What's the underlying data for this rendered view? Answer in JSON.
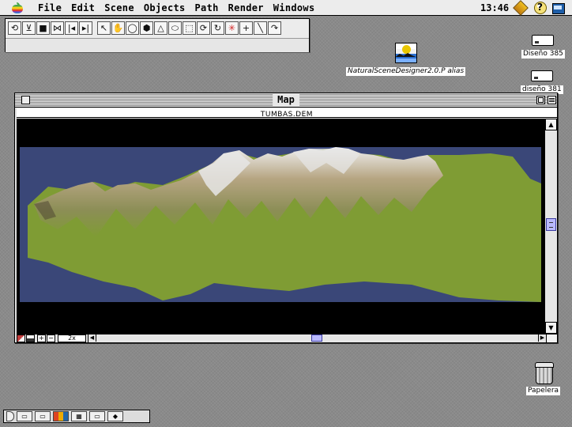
{
  "menubar": {
    "items": [
      "File",
      "Edit",
      "Scene",
      "Objects",
      "Path",
      "Render",
      "Windows"
    ],
    "clock": "13:46",
    "help_label": "?"
  },
  "toolbar": {
    "tools": [
      {
        "name": "undo-tool",
        "glyph": "⟲"
      },
      {
        "name": "stop-tool",
        "glyph": "⊻"
      },
      {
        "name": "pause-tool",
        "glyph": "■"
      },
      {
        "name": "center-tool",
        "glyph": "⋈"
      },
      {
        "name": "first-frame-tool",
        "glyph": "|◂"
      },
      {
        "name": "last-frame-tool",
        "glyph": "▸|"
      },
      {
        "name": "pointer-tool",
        "glyph": "↖"
      },
      {
        "name": "hand-tool",
        "glyph": "✋"
      },
      {
        "name": "sphere-tool",
        "glyph": "◯"
      },
      {
        "name": "cube-tool",
        "glyph": "⬢"
      },
      {
        "name": "cone-tool",
        "glyph": "△"
      },
      {
        "name": "cylinder-tool",
        "glyph": "⬭"
      },
      {
        "name": "selection-rectangle-tool",
        "glyph": "⬚"
      },
      {
        "name": "rotate-tool",
        "glyph": "⟳"
      },
      {
        "name": "orbit-tool",
        "glyph": "↻"
      },
      {
        "name": "light-tool",
        "glyph": "✳"
      },
      {
        "name": "crosshair-tool",
        "glyph": "+"
      },
      {
        "name": "line-tool",
        "glyph": "╲"
      },
      {
        "name": "path-tool",
        "glyph": "↷"
      }
    ]
  },
  "desktop": {
    "icons": [
      {
        "name": "disk-diseno-385",
        "label": "Diseño 385"
      },
      {
        "name": "disk-diseno-381",
        "label": "diseño 381"
      },
      {
        "name": "alias-natural-scene-designer",
        "label": "NaturalSceneDesigner2.0.P alias"
      },
      {
        "name": "trash",
        "label": "Papelera"
      }
    ]
  },
  "map_window": {
    "title": "Map",
    "document": "TUMBAS.DEM",
    "zoom_level": "2x",
    "plus_label": "+",
    "minus_label": "−"
  },
  "control_strip": {
    "items": [
      "▭",
      "▭",
      "▮",
      "▦",
      "▭",
      "◆"
    ]
  },
  "colors": {
    "water": "#3a4778",
    "grass": "#7f9c34",
    "snow": "#dadada",
    "rock": "#b9a784",
    "map_background": "#000000",
    "desktop": "#8a8a8a"
  }
}
